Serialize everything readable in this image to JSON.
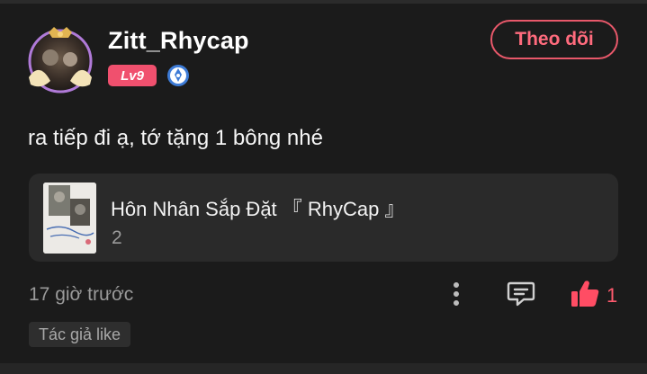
{
  "comment": {
    "username": "Zitt_Rhycap",
    "level": "Lv9",
    "follow_label": "Theo dõi",
    "text": "ra tiếp đi ạ, tớ tặng 1 bông nhé",
    "timestamp": "17 giờ trước",
    "like_count": "1",
    "author_like_tag": "Tác giả like"
  },
  "story": {
    "title": "Hôn Nhân Sắp Đặt 『 RhyCap 』",
    "count": "2"
  },
  "colors": {
    "background": "#1b1b1b",
    "card": "#2a2a2a",
    "accent": "#ff5a6e",
    "level_badge": "#f0506e",
    "muted_text": "#9a9a9a"
  },
  "icons": [
    "avatar",
    "verified-badge-icon",
    "more-vertical-icon",
    "reply-icon",
    "like-icon"
  ]
}
